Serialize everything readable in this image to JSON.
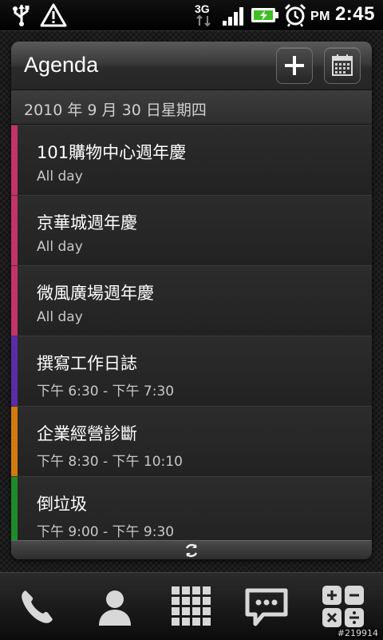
{
  "status_bar": {
    "network": "3G",
    "ampm": "PM",
    "time": "2:45"
  },
  "widget": {
    "title": "Agenda",
    "add_label": "+",
    "date": "2010 年 9 月 30 日星期四",
    "events": [
      {
        "title": "101購物中心週年慶",
        "time": "All day",
        "color": "#c4326a"
      },
      {
        "title": "京華城週年慶",
        "time": "All day",
        "color": "#c4326a"
      },
      {
        "title": "微風廣場週年慶",
        "time": "All day",
        "color": "#c4326a"
      },
      {
        "title": "撰寫工作日誌",
        "time": "下午 6:30 - 下午 7:30",
        "color": "#5a2ca8"
      },
      {
        "title": "企業經營診斷",
        "time": "下午 8:30 - 下午 10:10",
        "color": "#d27a10"
      },
      {
        "title": "倒垃圾",
        "time": "下午 9:00 - 下午 9:30",
        "color": "#1f8a2a"
      }
    ]
  },
  "dock": {
    "items": [
      "phone-icon",
      "people-icon",
      "all-apps-icon",
      "messages-icon",
      "calculator-icon"
    ]
  },
  "watermark": "#219914"
}
